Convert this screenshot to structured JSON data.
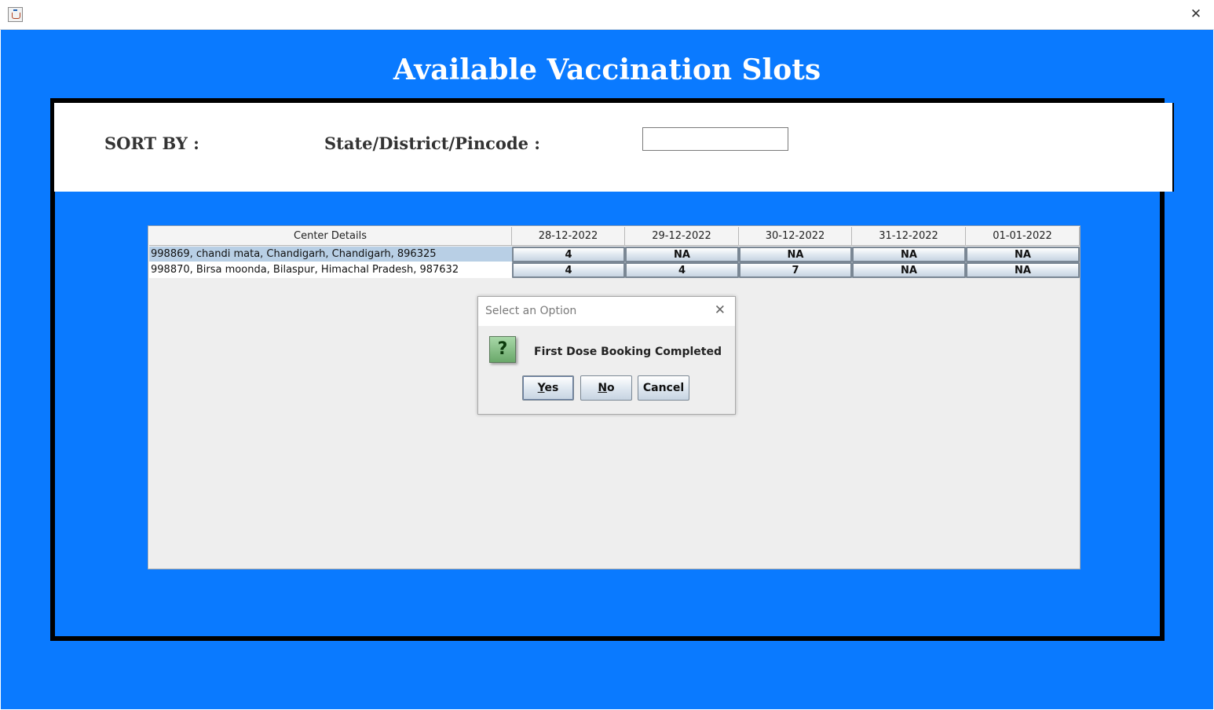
{
  "window": {
    "close_glyph": "✕"
  },
  "page": {
    "title": "Available Vaccination Slots"
  },
  "filter": {
    "sort_label": "SORT BY :",
    "field_label": "State/District/Pincode :",
    "input_value": ""
  },
  "table": {
    "headers": [
      "Center Details",
      "28-12-2022",
      "29-12-2022",
      "30-12-2022",
      "31-12-2022",
      "01-01-2022"
    ],
    "rows": [
      {
        "center": "998869, chandi mata, Chandigarh, Chandigarh, 896325",
        "slots": [
          "4",
          "NA",
          "NA",
          "NA",
          "NA"
        ]
      },
      {
        "center": "998870, Birsa moonda, Bilaspur, Himachal Pradesh, 987632",
        "slots": [
          "4",
          "4",
          "7",
          "NA",
          "NA"
        ]
      }
    ]
  },
  "dialog": {
    "title": "Select an Option",
    "close_glyph": "✕",
    "icon_glyph": "?",
    "message": "First Dose Booking Completed",
    "yes_mnemonic": "Y",
    "yes_rest": "es",
    "no_mnemonic": "N",
    "no_rest": "o",
    "cancel_label": "Cancel"
  },
  "colors": {
    "background_blue": "#0a7aff",
    "selected_row": "#b8cfe5",
    "icon_green": "#6aa86a"
  }
}
